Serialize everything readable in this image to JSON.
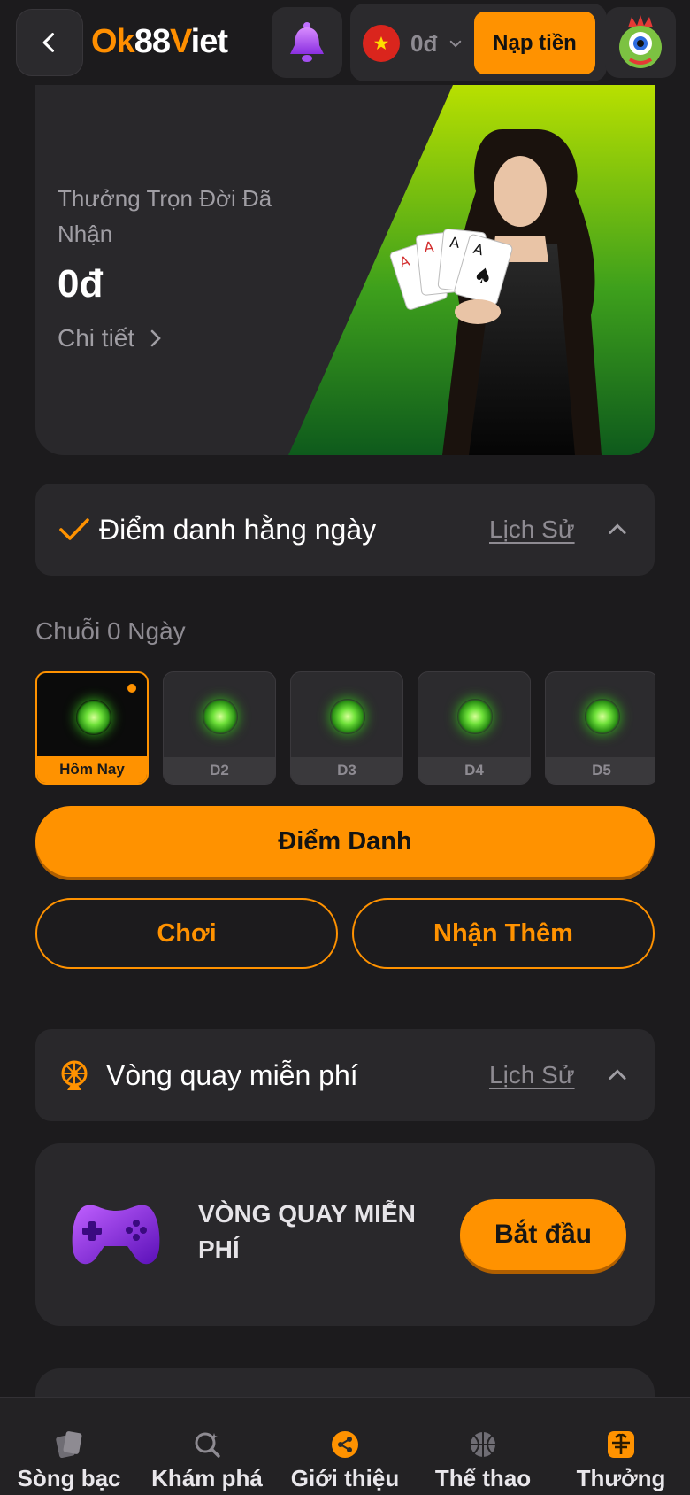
{
  "header": {
    "logo_ok": "Ok",
    "logo_num": "88",
    "logo_v": "V",
    "logo_iet": "iet",
    "balance": "0đ",
    "deposit_label": "Nạp tiền"
  },
  "hero": {
    "title": "Thưởng Trọn Đời Đã Nhận",
    "amount": "0đ",
    "detail_label": "Chi tiết"
  },
  "attendance": {
    "title": "Điểm danh hằng ngày",
    "history_label": "Lịch Sử",
    "streak_label": "Chuỗi 0 Ngày",
    "days": [
      "Hôm Nay",
      "D2",
      "D3",
      "D4",
      "D5"
    ],
    "checkin_label": "Điểm Danh",
    "play_label": "Chơi",
    "more_label": "Nhận Thêm"
  },
  "wheel": {
    "section_title": "Vòng quay miễn phí",
    "history_label": "Lịch Sử",
    "card_title": "VÒNG QUAY MIỄN PHÍ",
    "start_label": "Bắt đầu"
  },
  "nav": {
    "items": [
      {
        "label": "Sòng bạc",
        "icon": "cards-icon"
      },
      {
        "label": "Khám phá",
        "icon": "explore-icon"
      },
      {
        "label": "Giới thiệu",
        "icon": "share-icon"
      },
      {
        "label": "Thể thao",
        "icon": "ball-icon"
      },
      {
        "label": "Thưởng",
        "icon": "gift-icon"
      }
    ]
  },
  "colors": {
    "accent": "#ff9200",
    "background": "#1c1b1d",
    "card": "#29282b"
  }
}
